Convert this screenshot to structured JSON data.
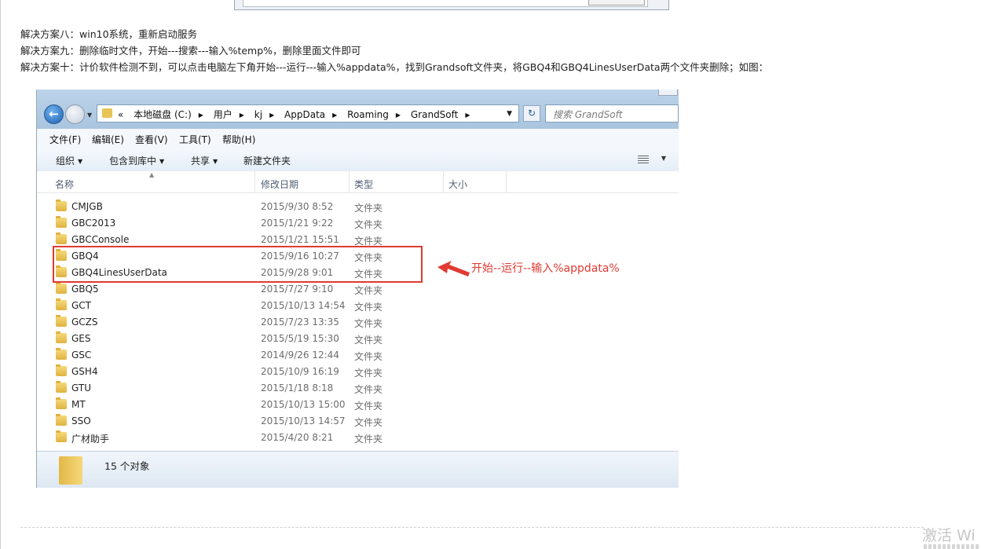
{
  "solutions": [
    "解决方案八：win10系统，重新启动服务",
    "解决方案九：删除临时文件，开始---搜索---输入%temp%，删除里面文件即可",
    "解决方案十：计价软件检测不到，可以点击电脑左下角开始---运行---输入%appdata%，找到Grandsoft文件夹，将GBQ4和GBQ4LinesUserData两个文件夹删除；如图："
  ],
  "explorer": {
    "breadcrumb": {
      "overflow": "«",
      "parts": [
        "本地磁盘 (C:)",
        "用户",
        "kj",
        "AppData",
        "Roaming",
        "GrandSoft"
      ]
    },
    "search_placeholder": "搜索 GrandSoft",
    "menu": [
      "文件(F)",
      "编辑(E)",
      "查看(V)",
      "工具(T)",
      "帮助(H)"
    ],
    "toolbar": [
      "组织",
      "包含到库中",
      "共享",
      "新建文件夹"
    ],
    "columns": [
      "名称",
      "修改日期",
      "类型",
      "大小"
    ],
    "files": [
      {
        "name": "CMJGB",
        "date": "2015/9/30 8:52",
        "type": "文件夹"
      },
      {
        "name": "GBC2013",
        "date": "2015/1/21 9:22",
        "type": "文件夹"
      },
      {
        "name": "GBCConsole",
        "date": "2015/1/21 15:51",
        "type": "文件夹"
      },
      {
        "name": "GBQ4",
        "date": "2015/9/16 10:27",
        "type": "文件夹"
      },
      {
        "name": "GBQ4LinesUserData",
        "date": "2015/9/28 9:01",
        "type": "文件夹"
      },
      {
        "name": "GBQ5",
        "date": "2015/7/27 9:10",
        "type": "文件夹"
      },
      {
        "name": "GCT",
        "date": "2015/10/13 14:54",
        "type": "文件夹"
      },
      {
        "name": "GCZS",
        "date": "2015/7/23 13:35",
        "type": "文件夹"
      },
      {
        "name": "GES",
        "date": "2015/5/19 15:30",
        "type": "文件夹"
      },
      {
        "name": "GSC",
        "date": "2014/9/26 12:44",
        "type": "文件夹"
      },
      {
        "name": "GSH4",
        "date": "2015/10/9 16:19",
        "type": "文件夹"
      },
      {
        "name": "GTU",
        "date": "2015/1/18 8:18",
        "type": "文件夹"
      },
      {
        "name": "MT",
        "date": "2015/10/13 15:00",
        "type": "文件夹"
      },
      {
        "name": "SSO",
        "date": "2015/10/13 14:57",
        "type": "文件夹"
      },
      {
        "name": "广材助手",
        "date": "2015/4/20 8:21",
        "type": "文件夹"
      }
    ],
    "status": "15 个对象"
  },
  "annotation": "开始--运行--输入%appdata%",
  "watermark": "激活 Wi",
  "colors": {
    "annotation": "#e03a32"
  }
}
